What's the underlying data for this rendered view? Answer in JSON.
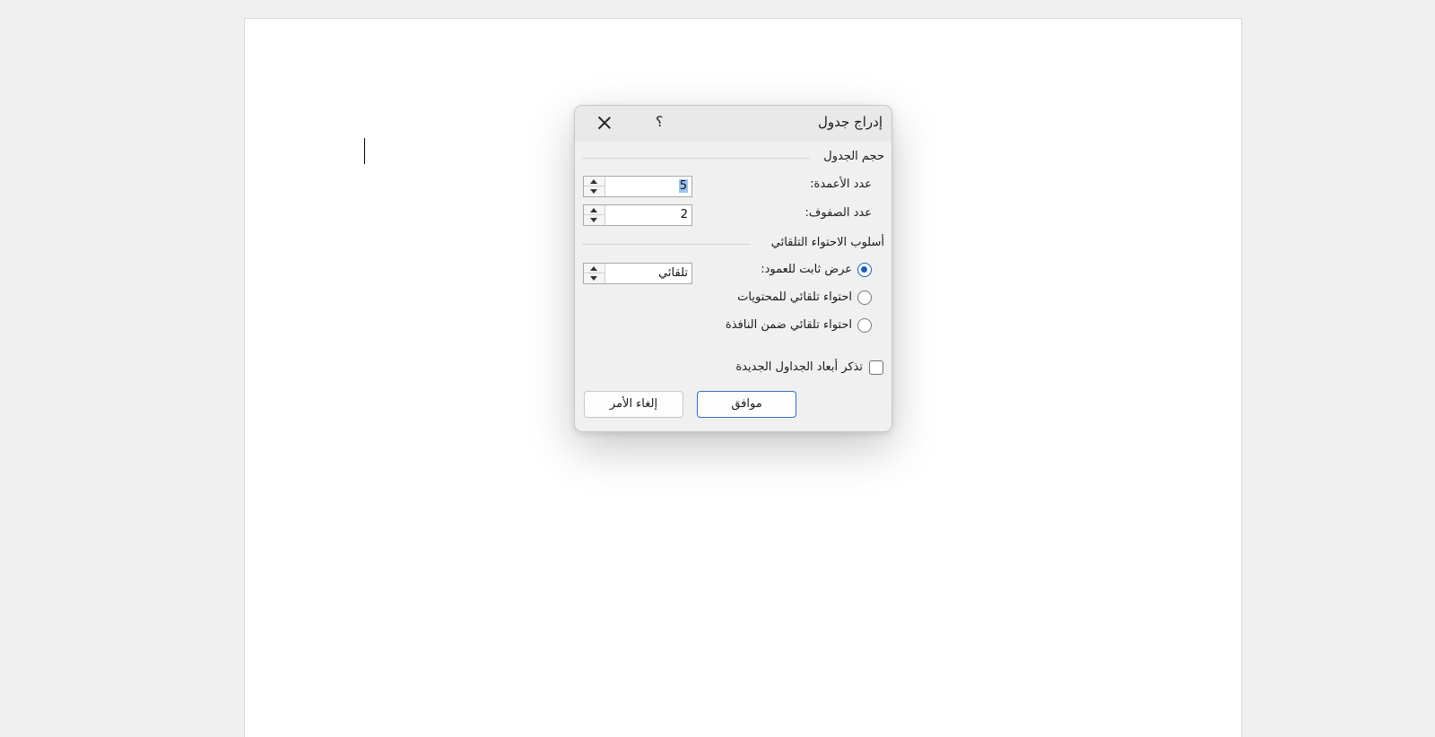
{
  "dialog": {
    "title": "إدراج جدول",
    "help_label": "؟"
  },
  "table_size": {
    "heading": "حجم الجدول",
    "columns_label": "عدد الأعمدة:",
    "columns_value": "5",
    "rows_label": "عدد الصفوف:",
    "rows_value": "2"
  },
  "autofit": {
    "heading": "أسلوب الاحتواء التلقائي",
    "options": [
      {
        "label": "عرض ثابت للعمود:",
        "checked": true
      },
      {
        "label": "احتواء تلقائي للمحتويات",
        "checked": false
      },
      {
        "label": "احتواء تلقائي ضمن النافذة",
        "checked": false
      }
    ],
    "fixed_width_value": "تلقائي"
  },
  "remember": {
    "label": "تذكر أبعاد الجداول الجديدة",
    "checked": false
  },
  "buttons": {
    "ok": "موافق",
    "cancel": "إلغاء الأمر"
  },
  "colors": {
    "accent": "#1b5fb1",
    "selection": "#9ec3ee"
  }
}
